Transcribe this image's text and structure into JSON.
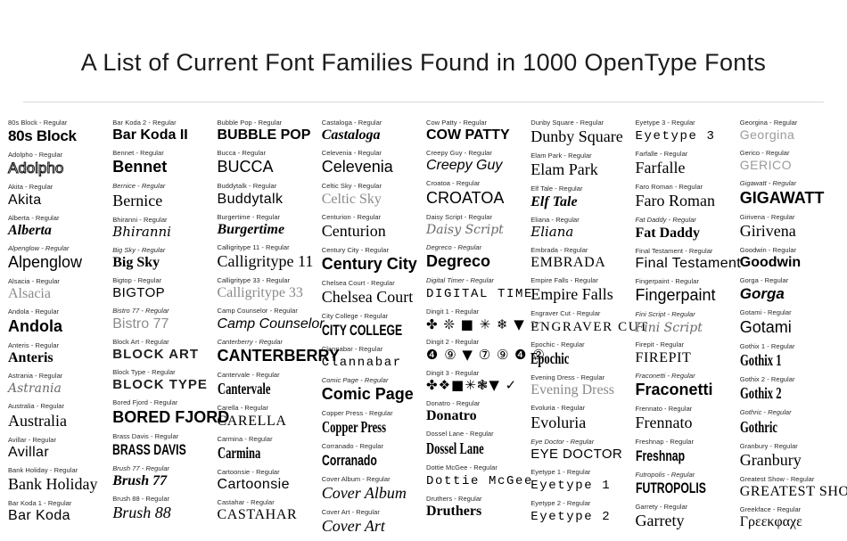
{
  "header": {
    "title": "A List of Current Font Families Found in 1000 OpenType Fonts"
  },
  "columns": [
    {
      "id": "column-1",
      "entries": [
        {
          "label": "80s Block - Regular",
          "sample": "80s Block",
          "style": "s-black",
          "label_italic": false
        },
        {
          "label": "Adolpho - Regular",
          "sample": "Adolpho",
          "style": "s-outline",
          "label_italic": false
        },
        {
          "label": "Akita - Regular",
          "sample": "Akita",
          "style": "s-sans-thin",
          "label_italic": false
        },
        {
          "label": "Alberta - Regular",
          "sample": "Alberta",
          "style": "s-ital-b",
          "label_italic": false
        },
        {
          "label": "Alpenglow - Regular",
          "sample": "Alpenglow",
          "style": "s-sans-lg",
          "label_italic": true
        },
        {
          "label": "Alsacia - Regular",
          "sample": "Alsacia",
          "style": "s-light-sr",
          "label_italic": false
        },
        {
          "label": "Andola - Regular",
          "sample": "Andola",
          "style": "s-sans-bl",
          "label_italic": false
        },
        {
          "label": "Anteris - Regular",
          "sample": "Anteris",
          "style": "s-serif-b",
          "label_italic": false
        },
        {
          "label": "Astrania - Regular",
          "sample": "Astrania",
          "style": "s-script-lt",
          "label_italic": false
        },
        {
          "label": "Australia - Regular",
          "sample": "Australia",
          "style": "s-serif-lg",
          "label_italic": false
        },
        {
          "label": "Avillar - Regular",
          "sample": "Avillar",
          "style": "s-sans-thin",
          "label_italic": false
        },
        {
          "label": "Bank Holiday - Regular",
          "sample": "Bank Holiday",
          "style": "s-serif-lg",
          "label_italic": false
        },
        {
          "label": "Bar Koda 1 - Regular",
          "sample": "Bar Koda",
          "style": "s-sans-thin",
          "label_italic": false
        }
      ]
    },
    {
      "id": "column-2",
      "entries": [
        {
          "label": "Bar Koda 2 - Regular",
          "sample": "Bar Koda II",
          "style": "s-sans-b",
          "label_italic": false
        },
        {
          "label": "Bennet - Regular",
          "sample": "Bennet",
          "style": "s-sans-bl",
          "label_italic": false
        },
        {
          "label": "Bernice - Regular",
          "sample": "Bernice",
          "style": "s-serif-lg",
          "label_italic": true
        },
        {
          "label": "Bhiranni - Regular",
          "sample": "Bhiranni",
          "style": "s-script",
          "label_italic": false
        },
        {
          "label": "Big Sky - Regular",
          "sample": "Big Sky",
          "style": "s-serif-b",
          "label_italic": true
        },
        {
          "label": "Bigtop - Regular",
          "sample": "Bigtop",
          "style": "s-caps-sans",
          "label_italic": false
        },
        {
          "label": "Bistro 77 - Regular",
          "sample": "Bistro 77",
          "style": "s-light",
          "label_italic": true
        },
        {
          "label": "Block Art - Regular",
          "sample": "BLOCK ART",
          "style": "s-stencil",
          "label_italic": false
        },
        {
          "label": "Block Type - Regular",
          "sample": "BLOCK TYPE",
          "style": "s-stencil",
          "label_italic": false
        },
        {
          "label": "Bored Fjord - Regular",
          "sample": "BORED FJORD",
          "style": "s-sans-bl",
          "label_italic": false
        },
        {
          "label": "Brass Davis - Regular",
          "sample": "BRASS DAVIS",
          "style": "s-cond",
          "label_italic": false
        },
        {
          "label": "Brush 77 - Regular",
          "sample": "Brush 77",
          "style": "s-ital-b",
          "label_italic": true
        },
        {
          "label": "Brush 88 - Regular",
          "sample": "Brush 88",
          "style": "s-serif-ital-lg",
          "label_italic": false
        }
      ]
    },
    {
      "id": "column-3",
      "entries": [
        {
          "label": "Bubble Pop - Regular",
          "sample": "BUBBLE POP",
          "style": "s-sans-b",
          "label_italic": false
        },
        {
          "label": "Bucca - Regular",
          "sample": "BUCCA",
          "style": "s-sans-lg",
          "label_italic": false
        },
        {
          "label": "Buddytalk - Regular",
          "sample": "Buddytalk",
          "style": "s-sans-thin",
          "label_italic": false
        },
        {
          "label": "Burgertime - Regular",
          "sample": "Burgertime",
          "style": "s-ital-b",
          "label_italic": false
        },
        {
          "label": "Calligritype 11 - Regular",
          "sample": "Calligritype 11",
          "style": "s-serif-lg",
          "label_italic": false
        },
        {
          "label": "Calligritype 33 - Regular",
          "sample": "Calligritype 33",
          "style": "s-light-sr",
          "label_italic": false
        },
        {
          "label": "Camp Counselor - Regular",
          "sample": "Camp Counselor",
          "style": "s-ital-sans",
          "label_italic": false
        },
        {
          "label": "Canterberry - Regular",
          "sample": "CANTERBERRY",
          "style": "s-sans-bl",
          "label_italic": true
        },
        {
          "label": "Cantervale - Regular",
          "sample": "Cantervale",
          "style": "s-cond-sr",
          "label_italic": false
        },
        {
          "label": "Carella - Regular",
          "sample": "CARELLA",
          "style": "s-caps",
          "label_italic": false
        },
        {
          "label": "Carmina - Regular",
          "sample": "Carmina",
          "style": "s-cond-sr",
          "label_italic": false
        },
        {
          "label": "Cartoonsie - Regular",
          "sample": "Cartoonsie",
          "style": "s-sans-thin",
          "label_italic": false
        },
        {
          "label": "Castahar - Regular",
          "sample": "CASTAHAR",
          "style": "s-caps",
          "label_italic": false
        }
      ]
    },
    {
      "id": "column-4",
      "entries": [
        {
          "label": "Castaloga - Regular",
          "sample": "Castaloga",
          "style": "s-ital-b",
          "label_italic": false
        },
        {
          "label": "Celevenia - Regular",
          "sample": "Celevenia",
          "style": "s-sans-lg",
          "label_italic": false
        },
        {
          "label": "Celtic Sky - Regular",
          "sample": "Celtic Sky",
          "style": "s-light-sr",
          "label_italic": false
        },
        {
          "label": "Centurion - Regular",
          "sample": "Centurion",
          "style": "s-serif-lg",
          "label_italic": false
        },
        {
          "label": "Century City - Regular",
          "sample": "Century City",
          "style": "s-sans-bl",
          "label_italic": false
        },
        {
          "label": "Chelsea Court - Regular",
          "sample": "Chelsea Court",
          "style": "s-serif-lg",
          "label_italic": false
        },
        {
          "label": "City College - Regular",
          "sample": "CITY COLLEGE",
          "style": "s-cond",
          "label_italic": false
        },
        {
          "label": "Clannabar - Regular",
          "sample": "Clannabar",
          "style": "s-mono-sp",
          "label_italic": false
        },
        {
          "label": "Comic Page - Regular",
          "sample": "Comic Page",
          "style": "s-sans-bl",
          "label_italic": true
        },
        {
          "label": "Copper Press - Regular",
          "sample": "Copper Press",
          "style": "s-cond-sr",
          "label_italic": false
        },
        {
          "label": "Corranado - Regular",
          "sample": "Corranado",
          "style": "s-cond",
          "label_italic": false
        },
        {
          "label": "Cover Album - Regular",
          "sample": "Cover Album",
          "style": "s-serif-ital-lg",
          "label_italic": false
        },
        {
          "label": "Cover Art - Regular",
          "sample": "Cover Art",
          "style": "s-serif-ital-lg",
          "label_italic": false
        }
      ]
    },
    {
      "id": "column-5",
      "entries": [
        {
          "label": "Cow Patty - Regular",
          "sample": "COW PATTY",
          "style": "s-sans-b",
          "label_italic": false
        },
        {
          "label": "Creepy Guy - Regular",
          "sample": "Creepy Guy",
          "style": "s-ital-sans",
          "label_italic": false
        },
        {
          "label": "Croatoa - Regular",
          "sample": "CROATOA",
          "style": "s-sans-lg",
          "label_italic": false
        },
        {
          "label": "Daisy Script - Regular",
          "sample": "Daisy Script",
          "style": "s-script-lt",
          "label_italic": false
        },
        {
          "label": "Degreco - Regular",
          "sample": "Degreco",
          "style": "s-sans-bl",
          "label_italic": true
        },
        {
          "label": "Digital Timer - Regular",
          "sample": "DIGITAL TIME",
          "style": "s-mono-sp",
          "label_italic": true
        },
        {
          "label": "Dingit 1 - Regular",
          "sample": "✤ ❊ ■ ✳ ❄ ▼ ☞",
          "style": "s-ding",
          "label_italic": false
        },
        {
          "label": "Dingit 2 - Regular",
          "sample": "❹ ⑨ ▼ ⑦ ⑨ ❹    ②",
          "style": "s-ding",
          "label_italic": false
        },
        {
          "label": "Dingit 3 - Regular",
          "sample": "✤❖■✳❃▼ ✓",
          "style": "s-ding",
          "label_italic": false
        },
        {
          "label": "Donatro - Regular",
          "sample": "Donatro",
          "style": "s-serif-b",
          "label_italic": false
        },
        {
          "label": "Dossel Lane - Regular",
          "sample": "Dossel Lane",
          "style": "s-cond-sr",
          "label_italic": false
        },
        {
          "label": "Dottie McGee - Regular",
          "sample": "Dottie McGee",
          "style": "s-mono-sp",
          "label_italic": false
        },
        {
          "label": "Druthers - Regular",
          "sample": "Druthers",
          "style": "s-serif-b",
          "label_italic": false
        }
      ]
    },
    {
      "id": "column-6",
      "entries": [
        {
          "label": "Dunby Square - Regular",
          "sample": "Dunby Square",
          "style": "s-serif-lg",
          "label_italic": false
        },
        {
          "label": "Elam Park - Regular",
          "sample": "Elam Park",
          "style": "s-serif-lg",
          "label_italic": false
        },
        {
          "label": "Elf Tale - Regular",
          "sample": "Elf Tale",
          "style": "s-ital-b",
          "label_italic": false
        },
        {
          "label": "Eliana - Regular",
          "sample": "Eliana",
          "style": "s-script",
          "label_italic": false
        },
        {
          "label": "Embrada - Regular",
          "sample": "EMBRADA",
          "style": "s-caps",
          "label_italic": false
        },
        {
          "label": "Empire Falls - Regular",
          "sample": "Empire Falls",
          "style": "s-serif-lg",
          "label_italic": false
        },
        {
          "label": "Engraver Cut - Regular",
          "sample": "Engraver Cut",
          "style": "s-caps-wide",
          "label_italic": false
        },
        {
          "label": "Epochic - Regular",
          "sample": "Epochic",
          "style": "s-cond-sr",
          "label_italic": false
        },
        {
          "label": "Evening Dress - Regular",
          "sample": "Evening Dress",
          "style": "s-light-sr",
          "label_italic": false
        },
        {
          "label": "Evoluria - Regular",
          "sample": "Evoluria",
          "style": "s-serif-lg",
          "label_italic": false
        },
        {
          "label": "Eye Doctor - Regular",
          "sample": "EYE DOCTOR",
          "style": "s-caps-sans",
          "label_italic": true
        },
        {
          "label": "Eyetype 1 - Regular",
          "sample": "Eyetype 1",
          "style": "s-mono-sp",
          "label_italic": false
        },
        {
          "label": "Eyetype 2 - Regular",
          "sample": "Eyetype 2",
          "style": "s-mono-sp",
          "label_italic": false
        }
      ]
    },
    {
      "id": "column-7",
      "entries": [
        {
          "label": "Eyetype 3 - Regular",
          "sample": "Eyetype 3",
          "style": "s-mono-sp",
          "label_italic": false
        },
        {
          "label": "Farfalle - Regular",
          "sample": "Farfalle",
          "style": "s-serif-lg",
          "label_italic": false
        },
        {
          "label": "Faro Roman - Regular",
          "sample": "Faro Roman",
          "style": "s-serif-lg",
          "label_italic": false
        },
        {
          "label": "Fat Daddy - Regular",
          "sample": "Fat Daddy",
          "style": "s-serif-b",
          "label_italic": true
        },
        {
          "label": "Final Testament - Regular",
          "sample": "Final Testament",
          "style": "s-sans-thin",
          "label_italic": false
        },
        {
          "label": "Fingerpaint - Regular",
          "sample": "Fingerpaint",
          "style": "s-sans-lg",
          "label_italic": false
        },
        {
          "label": "Fini Script - Regular",
          "sample": "Fini Script",
          "style": "s-script-lt",
          "label_italic": true
        },
        {
          "label": "Firepit - Regular",
          "sample": "FIREPIT",
          "style": "s-caps",
          "label_italic": false
        },
        {
          "label": "Fraconetti - Regular",
          "sample": "Fraconetti",
          "style": "s-sans-bl",
          "label_italic": true
        },
        {
          "label": "Frennato - Regular",
          "sample": "Frennato",
          "style": "s-serif-lg",
          "label_italic": false
        },
        {
          "label": "Freshnap - Regular",
          "sample": "Freshnap",
          "style": "s-cond",
          "label_italic": false
        },
        {
          "label": "Futropolis - Regular",
          "sample": "FUTROPOLIS",
          "style": "s-cond",
          "label_italic": true
        },
        {
          "label": "Garrety - Regular",
          "sample": "Garrety",
          "style": "s-serif-lg",
          "label_italic": false
        }
      ]
    },
    {
      "id": "column-8",
      "entries": [
        {
          "label": "Georgina - Regular",
          "sample": "Georgina",
          "style": "s-dot",
          "label_italic": false
        },
        {
          "label": "Gerico - Regular",
          "sample": "GERICO",
          "style": "s-dot",
          "label_italic": false
        },
        {
          "label": "Gigawatt - Regular",
          "sample": "GIGAWATT",
          "style": "s-sans-bl",
          "label_italic": true
        },
        {
          "label": "Girivena - Regular",
          "sample": "Girivena",
          "style": "s-serif-lg",
          "label_italic": false
        },
        {
          "label": "Goodwin - Regular",
          "sample": "Goodwin",
          "style": "s-sans-b",
          "label_italic": false
        },
        {
          "label": "Gorga - Regular",
          "sample": "Gorga",
          "style": "s-bold-ital",
          "label_italic": false
        },
        {
          "label": "Gotami - Regular",
          "sample": "Gotami",
          "style": "s-sans-lg",
          "label_italic": false
        },
        {
          "label": "Gothix 1 - Regular",
          "sample": "Gothix 1",
          "style": "s-cond-sr",
          "label_italic": false
        },
        {
          "label": "Gothix 2 - Regular",
          "sample": "Gothix 2",
          "style": "s-cond-sr",
          "label_italic": false
        },
        {
          "label": "Gothric - Regular",
          "sample": "Gothric",
          "style": "s-cond-sr",
          "label_italic": true
        },
        {
          "label": "Granbury - Regular",
          "sample": "Granbury",
          "style": "s-serif-lg",
          "label_italic": false
        },
        {
          "label": "Greatest Show - Regular",
          "sample": "GREATEST SHOW",
          "style": "s-caps",
          "label_italic": false
        },
        {
          "label": "Greekface - Regular",
          "sample": "Γρεεκφαχε",
          "style": "s-greek",
          "label_italic": false
        }
      ]
    }
  ]
}
